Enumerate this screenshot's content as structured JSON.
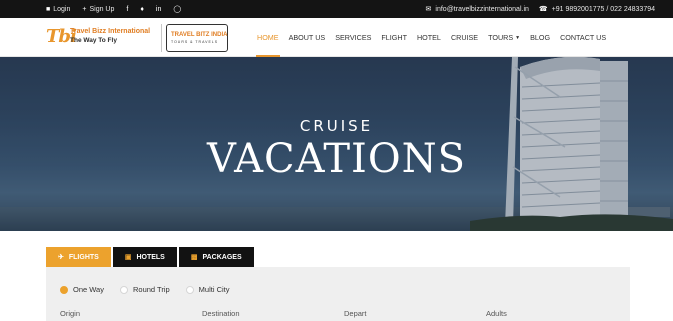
{
  "topbar": {
    "login": "Login",
    "signup": "Sign Up",
    "email": "info@travelbizzinternational.in",
    "phone": "+91 9892001775 / 022 24833794",
    "social": [
      "facebook-icon",
      "twitter-icon",
      "linkedin-icon",
      "instagram-icon"
    ]
  },
  "logo": {
    "mark": "Tbi",
    "name": "Travel Bizz International",
    "tagline": "The Way To Fly",
    "partner_name": "TRAVEL BITZ INDIA",
    "partner_sub": "TOURS & TRAVELS"
  },
  "nav": {
    "items": [
      {
        "label": "HOME",
        "active": true
      },
      {
        "label": "ABOUT US"
      },
      {
        "label": "SERVICES"
      },
      {
        "label": "FLIGHT"
      },
      {
        "label": "HOTEL"
      },
      {
        "label": "CRUISE"
      },
      {
        "label": "TOURS",
        "dropdown": true
      },
      {
        "label": "BLOG"
      },
      {
        "label": "CONTACT US"
      }
    ]
  },
  "hero": {
    "subtitle": "CRUISE",
    "title": "VACATIONS"
  },
  "booking": {
    "tabs": [
      {
        "label": "FLIGHTS",
        "icon": "plane-icon",
        "active": true
      },
      {
        "label": "HOTELS",
        "icon": "building-icon"
      },
      {
        "label": "PACKAGES",
        "icon": "suitcase-icon"
      }
    ],
    "trip_types": [
      {
        "label": "One Way",
        "selected": true
      },
      {
        "label": "Round Trip"
      },
      {
        "label": "Multi City"
      }
    ],
    "fields": [
      "Origin",
      "Destination",
      "Depart",
      "Adults"
    ]
  },
  "colors": {
    "accent": "#eca22d",
    "topbar": "#141414",
    "tab_dark": "#121212"
  }
}
